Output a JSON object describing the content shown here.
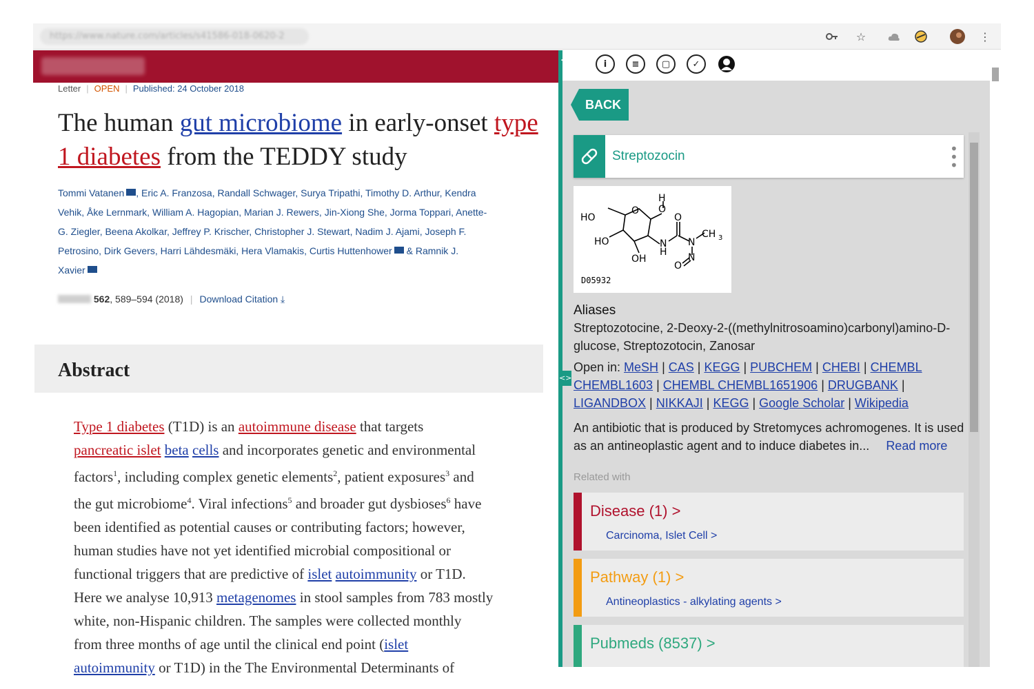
{
  "browser": {
    "url": "https://www.nature.com/articles/s41586-018-0620-2",
    "icons": [
      "key-icon",
      "star-icon",
      "extension-icon",
      "extension-icon-2",
      "avatar",
      "more-icon"
    ]
  },
  "article": {
    "type": "Letter",
    "access": "OPEN",
    "published": "Published: 24 October 2018",
    "title_part1": "The human ",
    "title_link1": "gut microbiome",
    "title_part2": " in early-onset ",
    "title_link2": "type 1 diabetes",
    "title_part3": " from the TEDDY study",
    "authors_l1": "Tommi Vatanen",
    "authors_l1b": ", Eric A. Franzosa, Randall Schwager, Surya Tripathi, Timothy D. Arthur, Kendra",
    "authors_l2": "Vehik, Åke Lernmark, William A. Hagopian, Marian J. Rewers, Jin-Xiong She, Jorma Toppari, Anette-",
    "authors_l3": "G. Ziegler, Beena Akolkar, Jeffrey P. Krischer, Christopher J. Stewart, Nadim J. Ajami, Joseph F.",
    "authors_l4": "Petrosino, Dirk Gevers, Harri Lähdesmäki, Hera Vlamakis, Curtis Huttenhower",
    "authors_l4b": " & Ramnik J.",
    "authors_l5": "Xavier",
    "volume": "562",
    "pages": ", 589–594 (2018)",
    "download": "Download Citation ⤓",
    "abstract_title": "Abstract",
    "abstract": {
      "l1a": "Type 1 diabetes",
      "l1b": " (T1D) is an ",
      "l1c": "autoimmune disease",
      "l1d": " that targets",
      "l2a": "pancreatic islet",
      "l2b": " ",
      "l2c": "beta",
      "l2d": " ",
      "l2e": "cells",
      "l2f": " and incorporates genetic and environmental",
      "l3a": "factors",
      "s1": "1",
      "l3b": ", including complex genetic elements",
      "s2": "2",
      "l3c": ", patient exposures",
      "s3": "3",
      "l3d": " and",
      "l4a": "the gut microbiome",
      "s4": "4",
      "l4b": ". Viral infections",
      "s5": "5",
      "l4c": " and broader gut dysbioses",
      "s6": "6",
      "l4d": " have",
      "l5": "been identified as potential causes or contributing factors; however,",
      "l6": "human studies have not yet identified microbial compositional or",
      "l7a": "functional triggers that are predictive of ",
      "l7b": "islet",
      "l7c": " ",
      "l7d": "autoimmunity",
      "l7e": " or T1D.",
      "l8a": "Here we analyse 10,913 ",
      "l8b": "metagenomes",
      "l8c": " in stool samples from 783 mostly",
      "l9": "white, non-Hispanic children. The samples were collected monthly",
      "l10a": "from three months of age until the clinical end point (",
      "l10b": "islet",
      "l11a": "autoimmunity",
      "l11b": " or T1D) in the The Environmental Determinants of"
    }
  },
  "panel": {
    "collapse_top": "<<",
    "collapse_mid": "<>",
    "top_icons": [
      "info-icon",
      "comment-icon",
      "copy-icon",
      "check-icon",
      "user-icon"
    ],
    "back": "BACK",
    "drug_name": "Streptozocin",
    "structure_id": "D05932",
    "aliases_title": "Aliases",
    "aliases": "Streptozotocine, 2-Deoxy-2-((methylnitrosoamino)carbonyl)amino-D-glucose, Streptozotocin, Zanosar",
    "open_in_label": "Open in: ",
    "links": [
      "MeSH",
      "CAS",
      "KEGG",
      "PUBCHEM",
      "CHEBI",
      "CHEMBL CHEMBL1603",
      "CHEMBL CHEMBL1651906",
      "DRUGBANK",
      "LIGANDBOX",
      "NIKKAJI",
      "KEGG",
      "Google Scholar",
      "Wikipedia"
    ],
    "description": "An antibiotic that is produced by Stretomyces achromogenes. It is used as an antineoplastic agent and to induce diabetes in...",
    "read_more": "Read more",
    "related_label": "Related with",
    "related": [
      {
        "title": "Disease (1) >",
        "sub": "Carcinoma, Islet Cell >",
        "color": "#b0122d"
      },
      {
        "title": "Pathway (1) >",
        "sub": "Antineoplastics - alkylating agents >",
        "color": "#f39c12"
      },
      {
        "title": "Pubmeds (8537) >",
        "sub": "",
        "color": "#2ea87e"
      }
    ]
  }
}
